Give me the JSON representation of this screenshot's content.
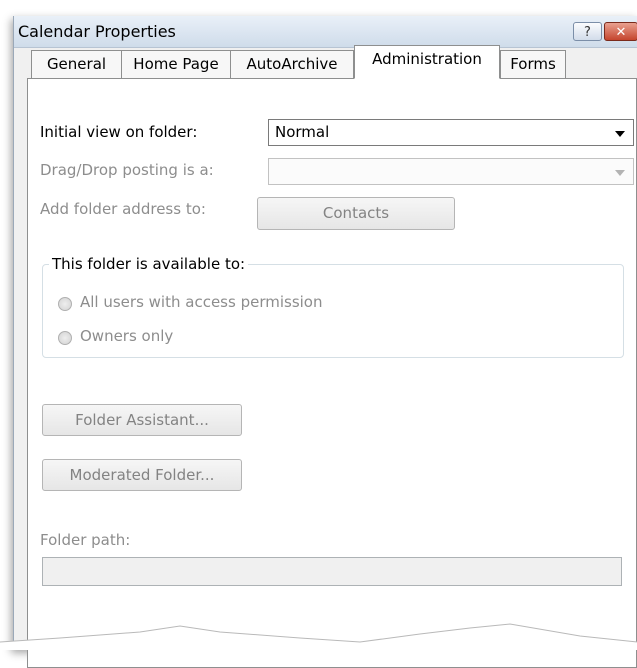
{
  "window": {
    "title": "Calendar Properties",
    "help_glyph": "?",
    "close_glyph": "✕"
  },
  "tabs": [
    {
      "label": "General",
      "active": false
    },
    {
      "label": "Home Page",
      "active": false
    },
    {
      "label": "AutoArchive",
      "active": false
    },
    {
      "label": "Administration",
      "active": true
    },
    {
      "label": "Forms",
      "active": false
    }
  ],
  "admin": {
    "initial_view_label": "Initial view on folder:",
    "initial_view_value": "Normal",
    "dragdrop_label": "Drag/Drop posting is a:",
    "dragdrop_value": "",
    "add_address_label": "Add folder address to:",
    "contacts_button": "Contacts",
    "availability_legend": "This folder is available to:",
    "availability_options": [
      {
        "label": "All users with access permission",
        "selected": false
      },
      {
        "label": "Owners only",
        "selected": false
      }
    ],
    "folder_assistant_button": "Folder Assistant...",
    "moderated_folder_button": "Moderated Folder...",
    "folder_path_label": "Folder path:",
    "folder_path_value": ""
  },
  "colors": {
    "dialog_bg": "#f0f0f0",
    "panel_bg": "#ffffff",
    "disabled_text": "#8d8d8d",
    "close_button": "#c5452e"
  }
}
